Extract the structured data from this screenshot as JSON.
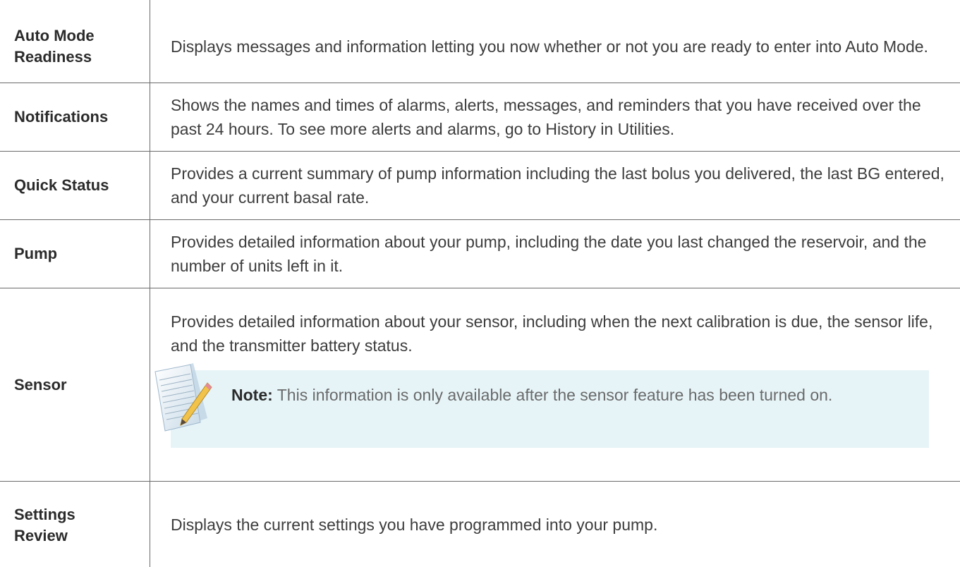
{
  "rows": [
    {
      "term_lines": [
        "Auto Mode",
        "Readiness"
      ],
      "description": "Displays messages and information letting you now whether or not you are ready to enter into Auto Mode."
    },
    {
      "term_lines": [
        "Notifications"
      ],
      "description": "Shows the names and times of alarms, alerts, messages, and reminders that you have received over the past 24 hours. To see more alerts and alarms, go to History in Utilities."
    },
    {
      "term_lines": [
        "Quick Status"
      ],
      "description": "Provides a current summary of pump information including the last bolus you delivered, the last BG entered, and your current basal rate."
    },
    {
      "term_lines": [
        "Pump"
      ],
      "description": "Provides detailed information about your pump, including the date you last changed the reservoir, and the number of units left in it."
    },
    {
      "term_lines": [
        "Sensor"
      ],
      "description": "Provides detailed information about your sensor, including when the next calibration is due, the sensor life, and the transmitter battery status.",
      "note": {
        "label": "Note:",
        "text": " This information is only available after the sensor feature has been turned on.",
        "icon": "note-pencil-icon"
      }
    },
    {
      "term_lines": [
        "Settings",
        "Review"
      ],
      "description": "Displays the current settings you have programmed into your pump."
    }
  ],
  "colors": {
    "note_background": "#e6f4f8",
    "rule": "#6a6a6a",
    "note_text": "#6a6a6a"
  }
}
